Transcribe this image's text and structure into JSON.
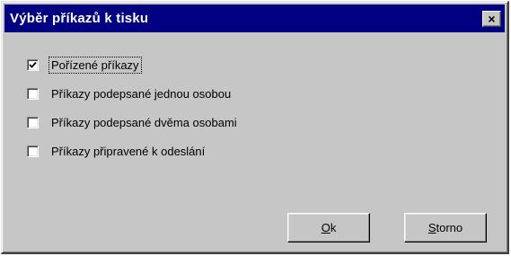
{
  "dialog": {
    "title": "Výběr příkazů k tisku",
    "close_glyph": "×"
  },
  "options": [
    {
      "label": "Pořízené příkazy",
      "checked": true
    },
    {
      "label": "Příkazy podepsané jednou osobou",
      "checked": false
    },
    {
      "label": "Příkazy podepsané dvěma osobami",
      "checked": false
    },
    {
      "label": "Příkazy připravené k odeslání",
      "checked": false
    }
  ],
  "buttons": {
    "ok_mnemonic": "O",
    "ok_rest": "k",
    "cancel_mnemonic": "S",
    "cancel_rest": "torno"
  },
  "colors": {
    "titlebar": "#000080",
    "face": "#c6c6c6"
  },
  "icons": {
    "close": "close-icon",
    "check": "checkmark-icon"
  }
}
